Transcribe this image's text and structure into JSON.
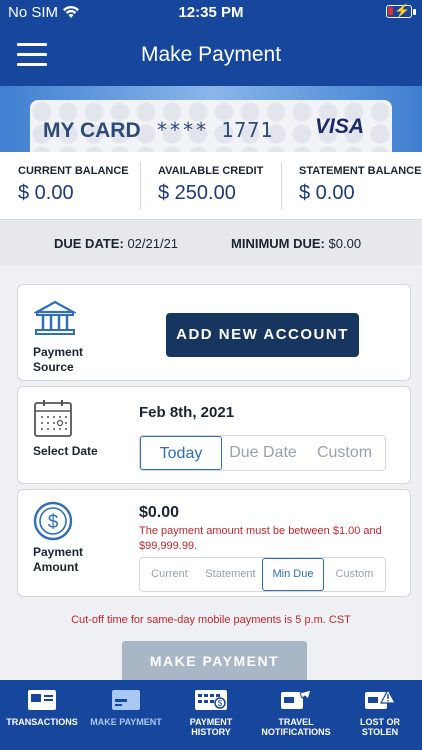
{
  "status": {
    "carrier": "No SIM",
    "time": "12:35 PM"
  },
  "header": {
    "title": "Make Payment"
  },
  "card": {
    "name": "MY CARD",
    "masked_number": "**** 1771",
    "brand": "VISA"
  },
  "balances": [
    {
      "label": "CURRENT BALANCE",
      "value": "$ 0.00"
    },
    {
      "label": "AVAILABLE CREDIT",
      "value": "$ 250.00"
    },
    {
      "label": "STATEMENT BALANCE",
      "value": "$ 0.00"
    }
  ],
  "due": {
    "due_label": "DUE DATE:",
    "due_value": "02/21/21",
    "min_label": "MINIMUM DUE:",
    "min_value": "$0.00"
  },
  "source": {
    "label_line1": "Payment",
    "label_line2": "Source",
    "button": "ADD NEW ACCOUNT"
  },
  "date": {
    "label": "Select Date",
    "value": "Feb 8th, 2021",
    "options": [
      "Today",
      "Due Date",
      "Custom"
    ],
    "selected": "Today"
  },
  "amount": {
    "label_line1": "Payment",
    "label_line2": "Amount",
    "value": "$0.00",
    "error": "The payment amount must be between $1.00 and $99,999.99.",
    "options": [
      "Current",
      "Statement",
      "Min Due",
      "Custom"
    ],
    "selected": "Min Due"
  },
  "cutoff": "Cut-off time for same-day mobile payments is 5 p.m. CST",
  "actions": {
    "make_payment": "MAKE PAYMENT"
  },
  "tabs": [
    {
      "line1": "TRANSACTIONS",
      "line2": "",
      "icon": "transactions-icon"
    },
    {
      "line1": "MAKE PAYMENT",
      "line2": "",
      "icon": "card-icon",
      "active": true
    },
    {
      "line1": "PAYMENT",
      "line2": "HISTORY",
      "icon": "history-icon"
    },
    {
      "line1": "TRAVEL",
      "line2": "NOTIFICATIONS",
      "icon": "travel-icon"
    },
    {
      "line1": "LOST OR",
      "line2": "STOLEN",
      "icon": "warning-card-icon"
    }
  ],
  "colors": {
    "primary": "#17479c",
    "button_dark": "#16365f",
    "error": "#c0272d",
    "active": "#2e6fb8"
  }
}
